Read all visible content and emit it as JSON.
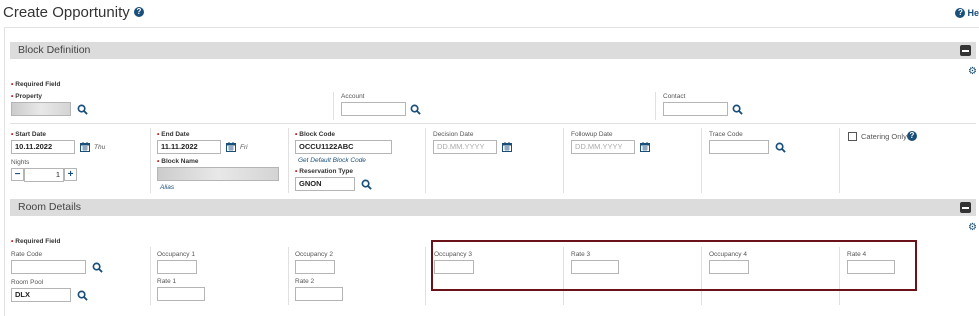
{
  "page": {
    "title": "Create Opportunity",
    "help_label": "He"
  },
  "block_definition": {
    "header": "Block Definition",
    "required_field": "Required Field",
    "property": {
      "label": "Property"
    },
    "account": {
      "label": "Account"
    },
    "contact": {
      "label": "Contact"
    },
    "start_date": {
      "label": "Start Date",
      "value": "10.11.2022",
      "day": "Thu"
    },
    "end_date": {
      "label": "End Date",
      "value": "11.11.2022",
      "day": "Fri"
    },
    "nights": {
      "label": "Nights",
      "value": "1",
      "minus": "−",
      "plus": "+"
    },
    "block_name": {
      "label": "Block Name",
      "alias_link": "Alias"
    },
    "block_code": {
      "label": "Block Code",
      "value": "OCCU1122ABC",
      "default_link": "Get Default Block Code"
    },
    "reservation_type": {
      "label": "Reservation Type",
      "value": "GNON"
    },
    "decision_date": {
      "label": "Decision Date",
      "placeholder": "DD.MM.YYYY"
    },
    "followup_date": {
      "label": "Followup Date",
      "placeholder": "DD.MM.YYYY"
    },
    "trace_code": {
      "label": "Trace Code"
    },
    "catering_only": {
      "label": "Catering Only",
      "checked": false
    }
  },
  "room_details": {
    "header": "Room Details",
    "required_field": "Required Field",
    "rate_code": {
      "label": "Rate Code"
    },
    "room_pool": {
      "label": "Room Pool",
      "value": "DLX"
    },
    "occupancy_1": {
      "label": "Occupancy 1"
    },
    "rate_1": {
      "label": "Rate 1"
    },
    "occupancy_2": {
      "label": "Occupancy 2"
    },
    "rate_2": {
      "label": "Rate 2"
    },
    "occupancy_3": {
      "label": "Occupancy 3"
    },
    "rate_3": {
      "label": "Rate 3"
    },
    "occupancy_4": {
      "label": "Occupancy 4"
    },
    "rate_4": {
      "label": "Rate 4"
    }
  },
  "colors": {
    "accent": "#1a4f7a",
    "required": "#cc0000",
    "highlight": "#6b1118",
    "band": "#dcdcdc"
  }
}
